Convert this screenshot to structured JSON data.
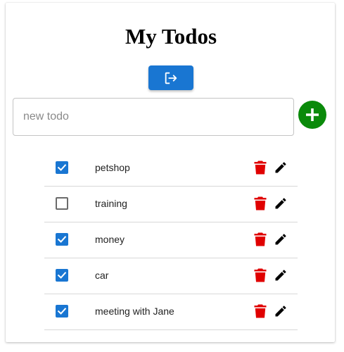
{
  "app": {
    "title": "My Todos"
  },
  "toolbar": {
    "logout_icon": "logout-icon",
    "add_icon": "add-circle-icon"
  },
  "new_todo": {
    "value": "",
    "placeholder": "new todo"
  },
  "colors": {
    "primary": "#1976d2",
    "add": "#0a8a0a",
    "delete": "#e00000",
    "edit": "#000000"
  },
  "todos": [
    {
      "text": "petshop",
      "done": true
    },
    {
      "text": "training",
      "done": false
    },
    {
      "text": "money",
      "done": true
    },
    {
      "text": "car",
      "done": true
    },
    {
      "text": "meeting with Jane",
      "done": true
    }
  ]
}
